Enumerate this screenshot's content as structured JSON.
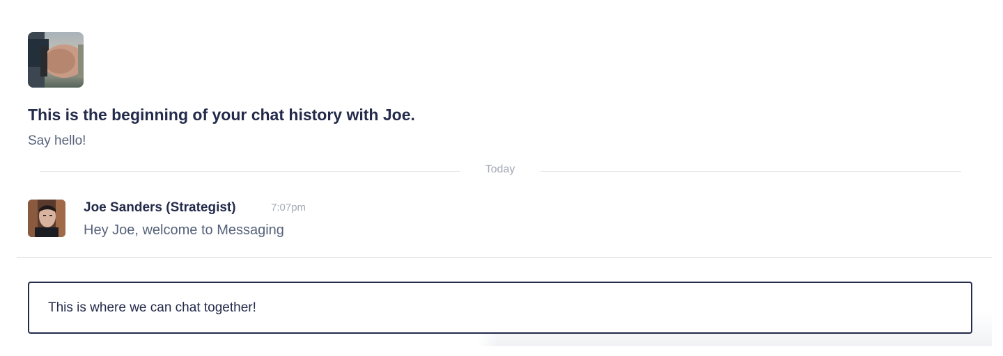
{
  "intro": {
    "title": "This is the beginning of your chat history with Joe.",
    "subtitle": "Say hello!"
  },
  "divider": {
    "label": "Today"
  },
  "message": {
    "author": "Joe Sanders (Strategist)",
    "time": "7:07pm",
    "text": "Hey Joe, welcome to Messaging"
  },
  "composer": {
    "placeholder": "This is where we can chat together!"
  },
  "colors": {
    "heading": "#232a4a",
    "body_text": "#56627a",
    "muted": "#a3a9b6",
    "divider": "#e3e5ea",
    "input_border": "#232a4a"
  },
  "icons": {
    "intro_avatar": "user-avatar-photo",
    "message_avatar": "user-avatar-photo"
  }
}
